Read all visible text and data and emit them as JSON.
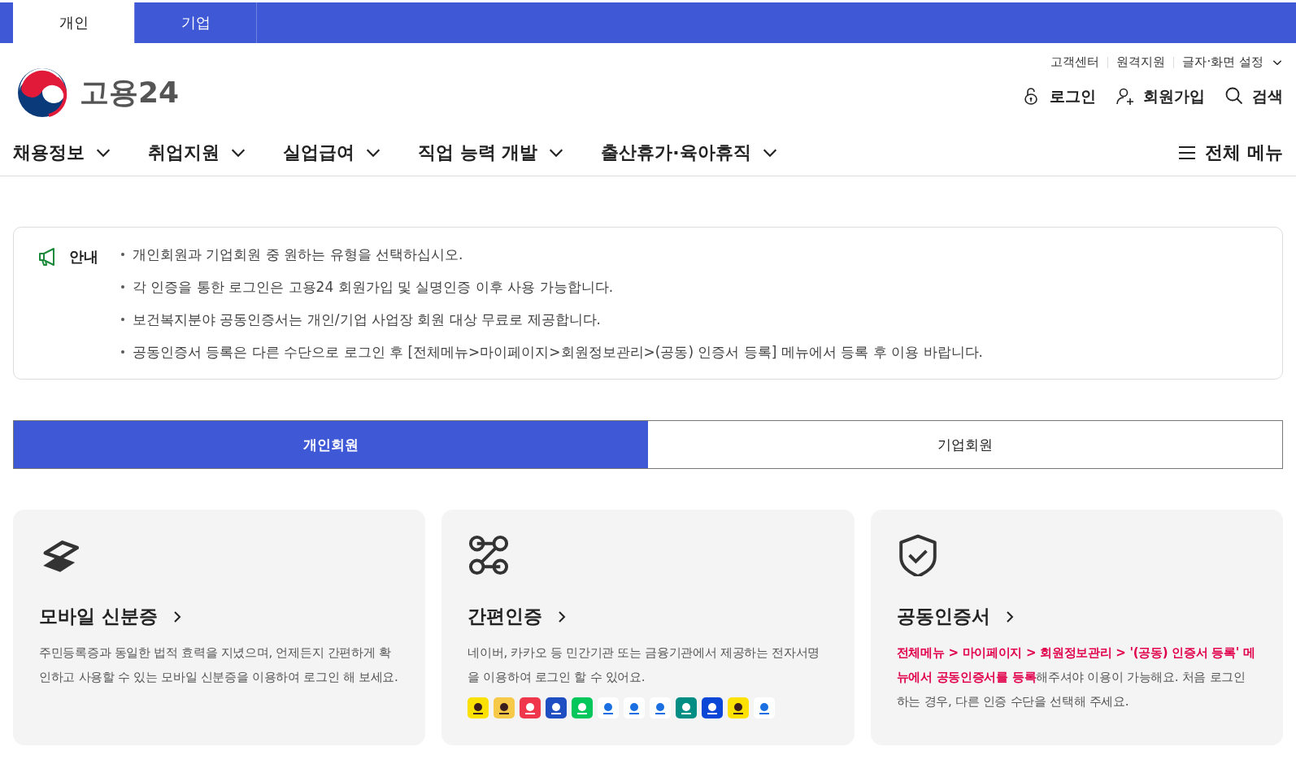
{
  "user_tabs": [
    {
      "label": "개인",
      "selected": true
    },
    {
      "label": "기업",
      "selected": false
    }
  ],
  "logo": {
    "text": "고용24"
  },
  "utility_links": [
    "고객센터",
    "원격지원",
    "글자·화면 설정"
  ],
  "account_links": [
    {
      "kind": "login",
      "label": "로그인"
    },
    {
      "kind": "signup",
      "label": "회원가입"
    },
    {
      "kind": "search",
      "label": "검색"
    }
  ],
  "nav": [
    "채용정보",
    "취업지원",
    "실업급여",
    "직업 능력 개발",
    "출산휴가·육아휴직"
  ],
  "all_menu": "전체 메뉴",
  "notice": {
    "title": "안내",
    "items": [
      "개인회원과 기업회원 중 원하는 유형을 선택하십시오.",
      "각 인증을 통한 로그인은 고용24 회원가입 및 실명인증 이후 사용 가능합니다.",
      "보건복지분야 공동인증서는 개인/기업 사업장 회원 대상 무료로 제공합니다.",
      "공동인증서 등록은 다른 수단으로 로그인 후 [전체메뉴>마이페이지>회원정보관리>(공동) 인증서 등록] 메뉴에서 등록 후 이용 바랍니다."
    ]
  },
  "member_tabs": [
    {
      "label": "개인회원",
      "selected": true
    },
    {
      "label": "기업회원",
      "selected": false
    }
  ],
  "cards": [
    {
      "kind": "mobile-id",
      "title": "모바일 신분증",
      "description": "주민등록증과 동일한 법적 효력을 지녔으며, 언제든지 간편하게 확인하고 사용할 수 있는 모바일 신분증을 이용하여 로그인 해 보세요."
    },
    {
      "kind": "simple-auth",
      "title": "간편인증",
      "description": "네이버, 카카오 등 민간기관 또는 금융기관에서 제공하는 전자서명을 이용하여 로그인 할 수 있어요.",
      "providers": [
        {
          "color": "#fae100"
        },
        {
          "color": "#f7c948"
        },
        {
          "color": "#f0364a"
        },
        {
          "color": "#1e4fc2"
        },
        {
          "color": "#03c75a"
        },
        {
          "color": "#ffffff"
        },
        {
          "color": "#ffffff"
        },
        {
          "color": "#ffffff"
        },
        {
          "color": "#008e84"
        },
        {
          "color": "#0a47d6"
        },
        {
          "color": "#ffe100"
        },
        {
          "color": "#ffffff"
        }
      ]
    },
    {
      "kind": "certificate",
      "title": "공동인증서",
      "description": "**전체메뉴 > 마이페이지 > 회원정보관리 > '(공동) 인증서 등록' 메뉴에서 공동인증서를 등록**해주셔야 이용이 가능해요. 처음 로그인 하는 경우, 다른 인증 수단을 선택해 주세요."
    }
  ]
}
